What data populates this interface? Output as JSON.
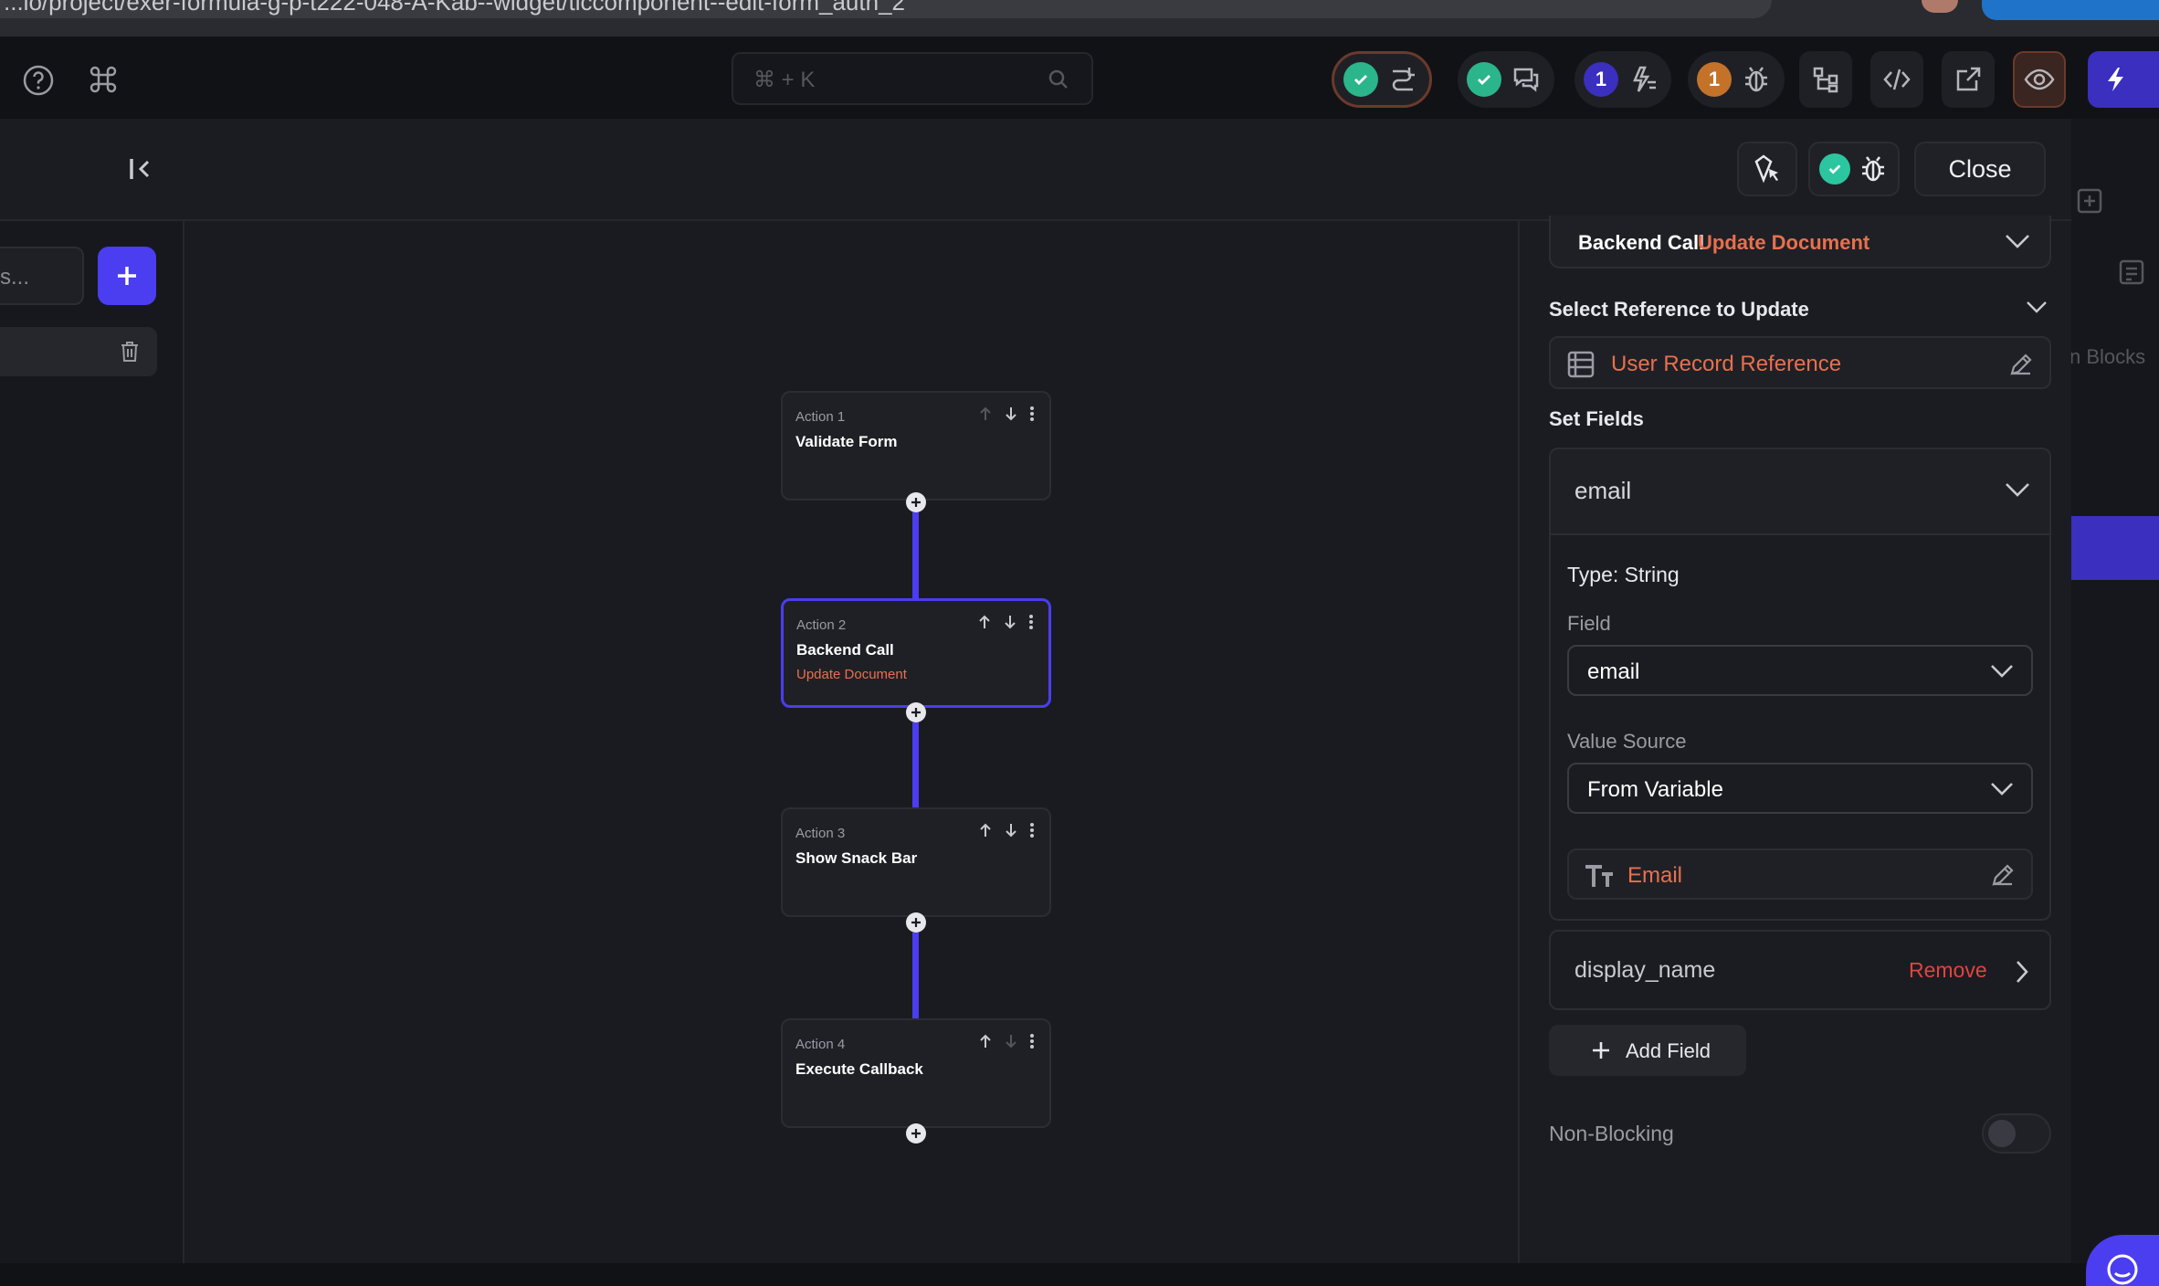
{
  "browser": {
    "url": "...io/project/exer-formula-g-p-t222-048-A-Kab--widget/ticcomponent--edit-form_auth_2"
  },
  "toolbar": {
    "search_placeholder": "⌘ + K",
    "badge_count_1": "1",
    "badge_count_2": "1",
    "accent_color": "#4b3df0"
  },
  "modal": {
    "close_label": "Close",
    "left": {
      "search_placeholder": "s..."
    }
  },
  "actions": [
    {
      "number": "Action 1",
      "title": "Validate Form",
      "subtitle": ""
    },
    {
      "number": "Action 2",
      "title": "Backend Call",
      "subtitle": "Update Document"
    },
    {
      "number": "Action 3",
      "title": "Show Snack Bar",
      "subtitle": ""
    },
    {
      "number": "Action 4",
      "title": "Execute Callback",
      "subtitle": ""
    }
  ],
  "panel": {
    "action_type": "Backend Call",
    "action_subtype": "Update Document",
    "select_reference_label": "Select Reference to Update",
    "reference_value": "User Record Reference",
    "set_fields_label": "Set Fields",
    "field_group": {
      "name": "email",
      "type_label": "Type: String",
      "field_label": "Field",
      "field_value": "email",
      "value_source_label": "Value Source",
      "value_source_value": "From Variable",
      "variable_value": "Email"
    },
    "field_row_2": {
      "name": "display_name",
      "remove_label": "Remove"
    },
    "add_field_label": "Add Field",
    "non_blocking_label": "Non-Blocking",
    "non_blocking_on": false
  },
  "right_edge": {
    "blocks_label": "n Blocks"
  }
}
